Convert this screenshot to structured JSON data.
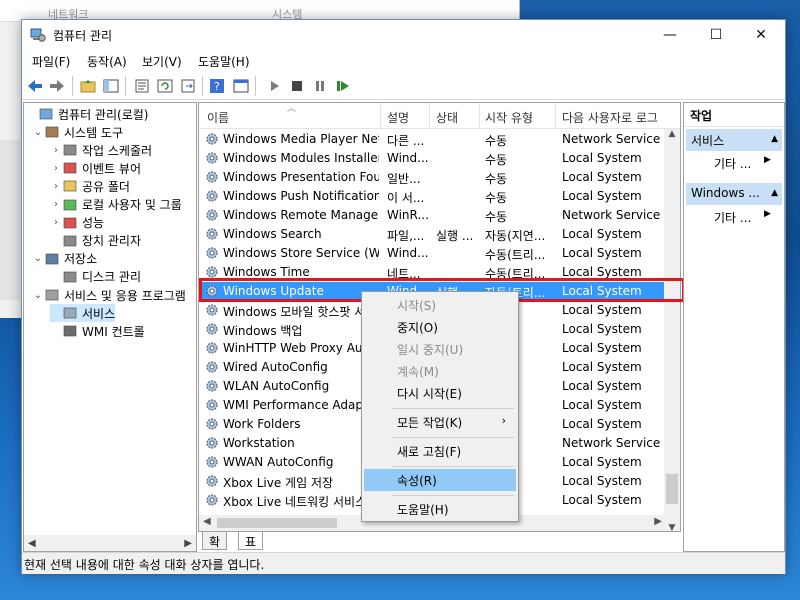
{
  "background_window": {
    "col1": "네트워크",
    "col2": "시스템"
  },
  "window": {
    "title": "컴퓨터 관리",
    "minimize": "—",
    "maximize": "☐",
    "close": "✕"
  },
  "menu": [
    "파일(F)",
    "동작(A)",
    "보기(V)",
    "도움말(H)"
  ],
  "tree": {
    "items": [
      {
        "label": "컴퓨터 관리(로컬)",
        "level": 0,
        "chev": ""
      },
      {
        "label": "시스템 도구",
        "level": 1,
        "chev": "⌄"
      },
      {
        "label": "작업 스케줄러",
        "level": 2,
        "chev": "›"
      },
      {
        "label": "이벤트 뷰어",
        "level": 2,
        "chev": "›"
      },
      {
        "label": "공유 폴더",
        "level": 2,
        "chev": "›"
      },
      {
        "label": "로컬 사용자 및 그룹",
        "level": 2,
        "chev": "›"
      },
      {
        "label": "성능",
        "level": 2,
        "chev": "›"
      },
      {
        "label": "장치 관리자",
        "level": 2,
        "chev": ""
      },
      {
        "label": "저장소",
        "level": 1,
        "chev": "⌄"
      },
      {
        "label": "디스크 관리",
        "level": 2,
        "chev": ""
      },
      {
        "label": "서비스 및 응용 프로그램",
        "level": 1,
        "chev": "⌄"
      },
      {
        "label": "서비스",
        "level": 2,
        "chev": ""
      },
      {
        "label": "WMI 컨트롤",
        "level": 2,
        "chev": ""
      }
    ]
  },
  "list": {
    "columns": [
      "이름",
      "설명",
      "상태",
      "시작 유형",
      "다음 사용자로 로그"
    ],
    "rows": [
      {
        "name": "Windows Media Player Net...",
        "desc": "다른 ...",
        "status": "",
        "start": "수동",
        "logon": "Network Service"
      },
      {
        "name": "Windows Modules Installer",
        "desc": "Wind...",
        "status": "",
        "start": "수동",
        "logon": "Local System"
      },
      {
        "name": "Windows Presentation Fou...",
        "desc": "일반...",
        "status": "",
        "start": "수동",
        "logon": "Local System"
      },
      {
        "name": "Windows Push Notification...",
        "desc": "이 서...",
        "status": "",
        "start": "수동",
        "logon": "Local System"
      },
      {
        "name": "Windows Remote Manage...",
        "desc": "WinR...",
        "status": "",
        "start": "수동",
        "logon": "Network Service"
      },
      {
        "name": "Windows Search",
        "desc": "파일,...",
        "status": "실행 ...",
        "start": "자동(지연...",
        "logon": "Local System"
      },
      {
        "name": "Windows Store Service (W...",
        "desc": "Wind...",
        "status": "",
        "start": "수동(트리...",
        "logon": "Local System"
      },
      {
        "name": "Windows Time",
        "desc": "네트...",
        "status": "",
        "start": "수동(트리...",
        "logon": "Local System"
      },
      {
        "name": "Windows Update",
        "desc": "Wind...",
        "status": "실행 ...",
        "start": "자동(트리...",
        "logon": "Local System"
      },
      {
        "name": "Windows 모바일 핫스팟 서...",
        "desc": "",
        "status": "",
        "start": "",
        "logon": "Local System"
      },
      {
        "name": "Windows 백업",
        "desc": "",
        "status": "",
        "start": "",
        "logon": "Local System"
      },
      {
        "name": "WinHTTP Web Proxy Auto...",
        "desc": "",
        "status": "",
        "start": "",
        "logon": "Local System"
      },
      {
        "name": "Wired AutoConfig",
        "desc": "",
        "status": "",
        "start": "",
        "logon": "Local System"
      },
      {
        "name": "WLAN AutoConfig",
        "desc": "",
        "status": "",
        "start": "",
        "logon": "Local System"
      },
      {
        "name": "WMI Performance Adapter",
        "desc": "",
        "status": "",
        "start": "",
        "logon": "Local System"
      },
      {
        "name": "Work Folders",
        "desc": "",
        "status": "",
        "start": "",
        "logon": "Local System"
      },
      {
        "name": "Workstation",
        "desc": "",
        "status": "",
        "start": "",
        "logon": "Network Service"
      },
      {
        "name": "WWAN AutoConfig",
        "desc": "",
        "status": "",
        "start": "",
        "logon": "Local System"
      },
      {
        "name": "Xbox Live 게임 저장",
        "desc": "",
        "status": "",
        "start": "",
        "logon": "Local System"
      },
      {
        "name": "Xbox Live 네트워킹 서비스",
        "desc": "",
        "status": "",
        "start": "",
        "logon": "Local System"
      }
    ],
    "selected_index": 8
  },
  "tabs": [
    "확장",
    "표준"
  ],
  "actions": {
    "header": "작업",
    "group1": "서비스",
    "group1_item": "기타 ...",
    "group2": "Windows ...",
    "group2_item": "기타 ..."
  },
  "context_menu": {
    "start": "시작(S)",
    "stop": "중지(O)",
    "pause": "일시 중지(U)",
    "resume": "계속(M)",
    "restart": "다시 시작(E)",
    "all_tasks": "모든 작업(K)",
    "refresh": "새로 고침(F)",
    "properties": "속성(R)",
    "help": "도움말(H)"
  },
  "statusbar": "현재 선택 내용에 대한 속성 대화 상자를 엽니다.",
  "colors": {
    "selection": "#3399ff",
    "highlight_outline": "#e8141b",
    "context_hover": "#91c9f7",
    "action_group": "#c9dff5"
  }
}
